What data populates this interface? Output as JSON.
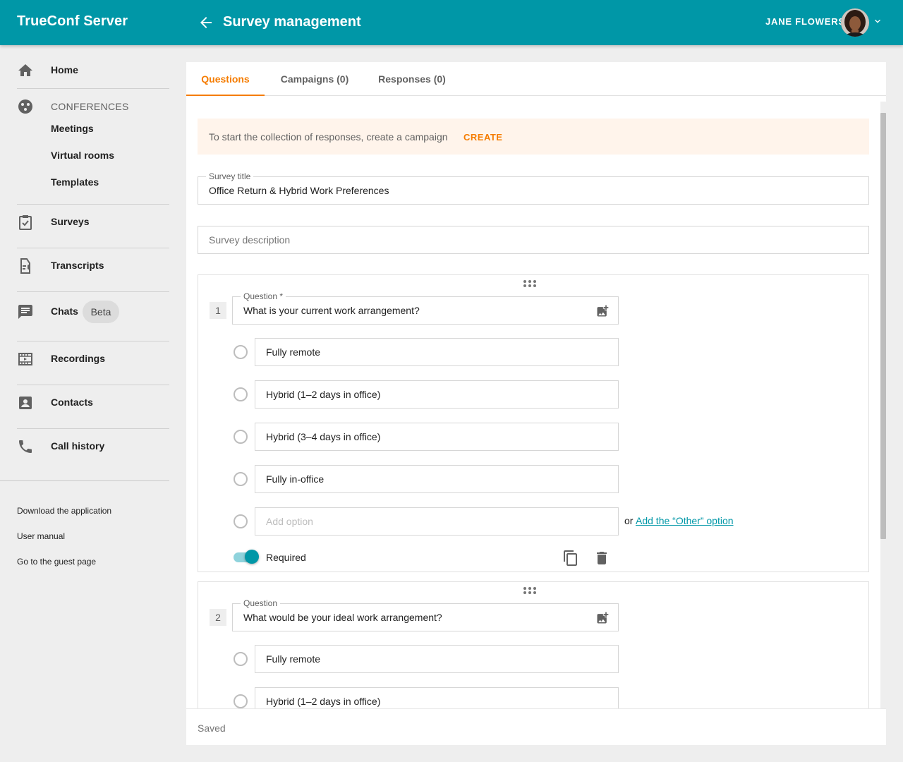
{
  "app": {
    "brand": "TrueConf Server",
    "page_title": "Survey management",
    "user_name": "JANE FLOWERS"
  },
  "sidebar": {
    "home": "Home",
    "conferences_section": "CONFERENCES",
    "meetings": "Meetings",
    "virtual_rooms": "Virtual rooms",
    "templates": "Templates",
    "surveys": "Surveys",
    "transcripts": "Transcripts",
    "chats": "Chats",
    "chats_badge": "Beta",
    "recordings": "Recordings",
    "contacts": "Contacts",
    "call_history": "Call history",
    "footer_links": [
      "Download the application",
      "User manual",
      "Go to the guest page"
    ]
  },
  "tabs": [
    {
      "label": "Questions",
      "active": true
    },
    {
      "label": "Campaigns (0)",
      "active": false
    },
    {
      "label": "Responses (0)",
      "active": false
    }
  ],
  "banner": {
    "text": "To start the collection of responses, create a campaign",
    "action": "CREATE"
  },
  "survey": {
    "title_label": "Survey title",
    "title_value": "Office Return & Hybrid Work Preferences",
    "description_placeholder": "Survey description"
  },
  "questions": [
    {
      "number": "1",
      "label": "Question *",
      "text": "What is your current work arrangement?",
      "options": [
        "Fully remote",
        "Hybrid (1–2 days in office)",
        "Hybrid (3–4 days in office)",
        "Fully in-office"
      ],
      "add_option_placeholder": "Add option",
      "or_text": "or",
      "add_other_link": "Add the “Other” option",
      "required_label": "Required",
      "required": true
    },
    {
      "number": "2",
      "label": "Question",
      "text": "What would be your ideal work arrangement?",
      "options": [
        "Fully remote",
        "Hybrid (1–2 days in office)"
      ]
    }
  ],
  "status": {
    "saved": "Saved"
  },
  "colors": {
    "primary": "#0097a7",
    "accent": "#f57c00",
    "banner_bg": "#fff4eb"
  }
}
